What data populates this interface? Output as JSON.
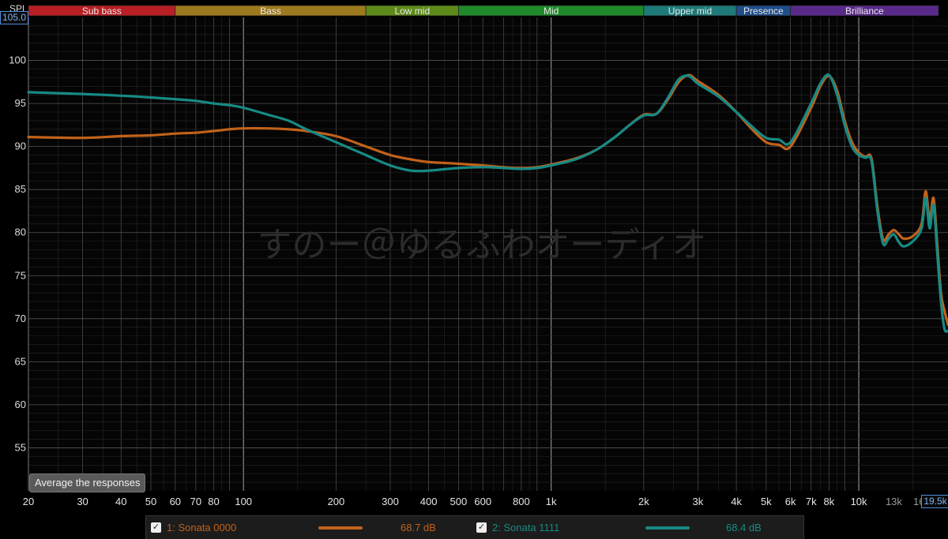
{
  "colors": {
    "background": "#000000",
    "grid_major": "#555555",
    "grid_minor": "#262626",
    "decade_line": "#8a8a8a",
    "series1": "#c2621a",
    "series2": "#178a84",
    "accent": "#4e8cd8"
  },
  "header": {
    "spl_label": "SPL",
    "ymax_box": "105.0",
    "xmax_box": "19.5k"
  },
  "bands": [
    {
      "label": "Sub bass",
      "from": 20,
      "to": 60,
      "color": "#b81f24"
    },
    {
      "label": "Bass",
      "from": 60,
      "to": 250,
      "color": "#9e7a1f"
    },
    {
      "label": "Low mid",
      "from": 250,
      "to": 500,
      "color": "#5e8a1a"
    },
    {
      "label": "Mid",
      "from": 500,
      "to": 2000,
      "color": "#1f8a2a"
    },
    {
      "label": "Upper mid",
      "from": 2000,
      "to": 4000,
      "color": "#1f7a7a"
    },
    {
      "label": "Presence",
      "from": 4000,
      "to": 6000,
      "color": "#1f4e8a"
    },
    {
      "label": "Brilliance",
      "from": 6000,
      "to": 20000,
      "color": "#5a2a8a"
    }
  ],
  "watermark": "すのー＠ゆるふわオーディオ",
  "avg_button": "Average the responses",
  "legend": [
    {
      "checked": "✓",
      "name": "1: Sonata 0000",
      "value": "68.7 dB",
      "color": "#c2621a"
    },
    {
      "checked": "✓",
      "name": "2: Sonata 1111",
      "value": "68.4 dB",
      "color": "#178a84"
    }
  ],
  "chart_data": {
    "type": "line",
    "title": "",
    "xlabel": "",
    "ylabel": "SPL",
    "x_scale": "log",
    "xlim": [
      20,
      19500
    ],
    "ylim": [
      50,
      105
    ],
    "grid": true,
    "y_ticks": [
      55,
      60,
      65,
      70,
      75,
      80,
      85,
      90,
      95,
      100
    ],
    "x_ticks": [
      {
        "v": 20,
        "label": "20"
      },
      {
        "v": 30,
        "label": "30"
      },
      {
        "v": 40,
        "label": "40"
      },
      {
        "v": 50,
        "label": "50"
      },
      {
        "v": 60,
        "label": "60"
      },
      {
        "v": 70,
        "label": "70"
      },
      {
        "v": 80,
        "label": "80"
      },
      {
        "v": 100,
        "label": "100"
      },
      {
        "v": 200,
        "label": "200"
      },
      {
        "v": 300,
        "label": "300"
      },
      {
        "v": 400,
        "label": "400"
      },
      {
        "v": 500,
        "label": "500"
      },
      {
        "v": 600,
        "label": "600"
      },
      {
        "v": 800,
        "label": "800"
      },
      {
        "v": 1000,
        "label": "1k"
      },
      {
        "v": 2000,
        "label": "2k"
      },
      {
        "v": 3000,
        "label": "3k"
      },
      {
        "v": 4000,
        "label": "4k"
      },
      {
        "v": 5000,
        "label": "5k"
      },
      {
        "v": 6000,
        "label": "6k"
      },
      {
        "v": 7000,
        "label": "7k"
      },
      {
        "v": 8000,
        "label": "8k"
      },
      {
        "v": 10000,
        "label": "10k"
      },
      {
        "v": 13000,
        "label": "13k"
      },
      {
        "v": 16000,
        "label": "16k"
      }
    ],
    "series": [
      {
        "name": "1: Sonata 0000",
        "color": "#c2621a",
        "points": [
          [
            20,
            91.1
          ],
          [
            30,
            91.0
          ],
          [
            40,
            91.2
          ],
          [
            50,
            91.3
          ],
          [
            60,
            91.5
          ],
          [
            70,
            91.6
          ],
          [
            80,
            91.8
          ],
          [
            90,
            92.0
          ],
          [
            100,
            92.1
          ],
          [
            120,
            92.1
          ],
          [
            140,
            92.0
          ],
          [
            160,
            91.8
          ],
          [
            200,
            91.2
          ],
          [
            250,
            90.0
          ],
          [
            300,
            89.0
          ],
          [
            350,
            88.5
          ],
          [
            400,
            88.2
          ],
          [
            500,
            88.0
          ],
          [
            600,
            87.8
          ],
          [
            700,
            87.6
          ],
          [
            800,
            87.5
          ],
          [
            900,
            87.6
          ],
          [
            1000,
            87.9
          ],
          [
            1200,
            88.6
          ],
          [
            1400,
            89.6
          ],
          [
            1600,
            91.0
          ],
          [
            1800,
            92.5
          ],
          [
            2000,
            93.7
          ],
          [
            2200,
            93.8
          ],
          [
            2400,
            95.5
          ],
          [
            2600,
            97.5
          ],
          [
            2800,
            98.3
          ],
          [
            3000,
            97.6
          ],
          [
            3500,
            96.0
          ],
          [
            4000,
            94.0
          ],
          [
            4500,
            92.0
          ],
          [
            5000,
            90.5
          ],
          [
            5500,
            90.2
          ],
          [
            6000,
            90.0
          ],
          [
            7000,
            94.5
          ],
          [
            7500,
            97.0
          ],
          [
            8000,
            98.2
          ],
          [
            8500,
            96.5
          ],
          [
            9000,
            93.0
          ],
          [
            9500,
            90.5
          ],
          [
            10000,
            89.3
          ],
          [
            10500,
            88.8
          ],
          [
            11000,
            88.6
          ],
          [
            11500,
            83.0
          ],
          [
            12000,
            79.2
          ],
          [
            12500,
            79.8
          ],
          [
            13000,
            80.3
          ],
          [
            13500,
            79.8
          ],
          [
            14000,
            79.3
          ],
          [
            15000,
            79.6
          ],
          [
            16000,
            81.0
          ],
          [
            16500,
            84.8
          ],
          [
            17000,
            81.5
          ],
          [
            17500,
            84.0
          ],
          [
            18000,
            78.5
          ],
          [
            18500,
            73.0
          ],
          [
            19000,
            70.9
          ],
          [
            19500,
            69.3
          ]
        ]
      },
      {
        "name": "2: Sonata 1111",
        "color": "#178a84",
        "points": [
          [
            20,
            96.3
          ],
          [
            30,
            96.1
          ],
          [
            40,
            95.9
          ],
          [
            50,
            95.7
          ],
          [
            60,
            95.5
          ],
          [
            70,
            95.3
          ],
          [
            80,
            95.0
          ],
          [
            90,
            94.8
          ],
          [
            100,
            94.5
          ],
          [
            120,
            93.7
          ],
          [
            140,
            93.0
          ],
          [
            160,
            92.0
          ],
          [
            200,
            90.5
          ],
          [
            250,
            89.0
          ],
          [
            300,
            87.8
          ],
          [
            350,
            87.2
          ],
          [
            400,
            87.2
          ],
          [
            500,
            87.5
          ],
          [
            600,
            87.6
          ],
          [
            700,
            87.5
          ],
          [
            800,
            87.4
          ],
          [
            900,
            87.5
          ],
          [
            1000,
            87.8
          ],
          [
            1200,
            88.5
          ],
          [
            1400,
            89.6
          ],
          [
            1600,
            91.0
          ],
          [
            1800,
            92.5
          ],
          [
            2000,
            93.6
          ],
          [
            2200,
            93.8
          ],
          [
            2400,
            95.7
          ],
          [
            2600,
            97.8
          ],
          [
            2800,
            98.2
          ],
          [
            3000,
            97.3
          ],
          [
            3500,
            95.8
          ],
          [
            4000,
            94.0
          ],
          [
            4500,
            92.3
          ],
          [
            5000,
            91.0
          ],
          [
            5500,
            90.8
          ],
          [
            6000,
            90.5
          ],
          [
            7000,
            95.0
          ],
          [
            7500,
            97.3
          ],
          [
            8000,
            98.3
          ],
          [
            8500,
            96.0
          ],
          [
            9000,
            92.5
          ],
          [
            9500,
            90.0
          ],
          [
            10000,
            89.0
          ],
          [
            10500,
            88.7
          ],
          [
            11000,
            88.3
          ],
          [
            11500,
            82.5
          ],
          [
            12000,
            78.7
          ],
          [
            12500,
            79.3
          ],
          [
            13000,
            79.8
          ],
          [
            13500,
            78.9
          ],
          [
            14000,
            78.4
          ],
          [
            15000,
            79.0
          ],
          [
            16000,
            80.5
          ],
          [
            16500,
            84.0
          ],
          [
            17000,
            80.5
          ],
          [
            17500,
            83.2
          ],
          [
            18000,
            77.5
          ],
          [
            18500,
            72.0
          ],
          [
            19000,
            68.8
          ],
          [
            19500,
            68.6
          ]
        ]
      }
    ]
  }
}
